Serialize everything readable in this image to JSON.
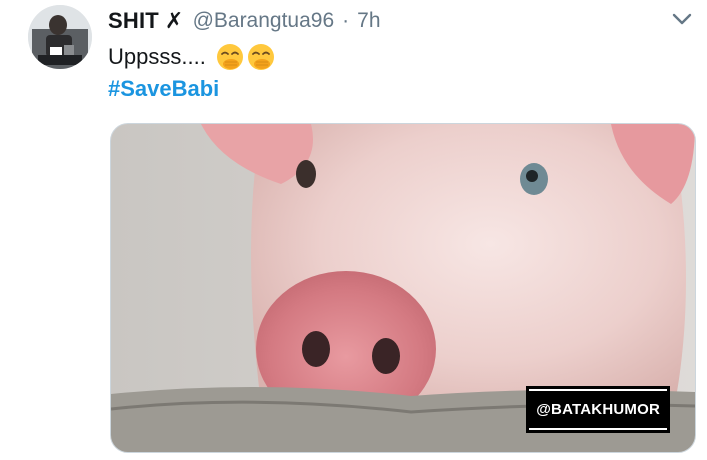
{
  "tweet": {
    "display_name": "SHIT",
    "name_glyph": "✗",
    "handle": "@Barangtua96",
    "separator": "·",
    "time": "7h",
    "text": "Uppsss....",
    "emojis": [
      "face-with-hand-over-mouth",
      "face-with-hand-over-mouth"
    ],
    "hashtag": "#SaveBabi",
    "media": {
      "subject": "pig",
      "watermark": "@BATAKHUMOR"
    }
  },
  "icons": {
    "menu": "chevron-down-icon"
  },
  "colors": {
    "name": "#14171a",
    "muted": "#657786",
    "link": "#1b95e0",
    "border": "#ccd6dd"
  }
}
